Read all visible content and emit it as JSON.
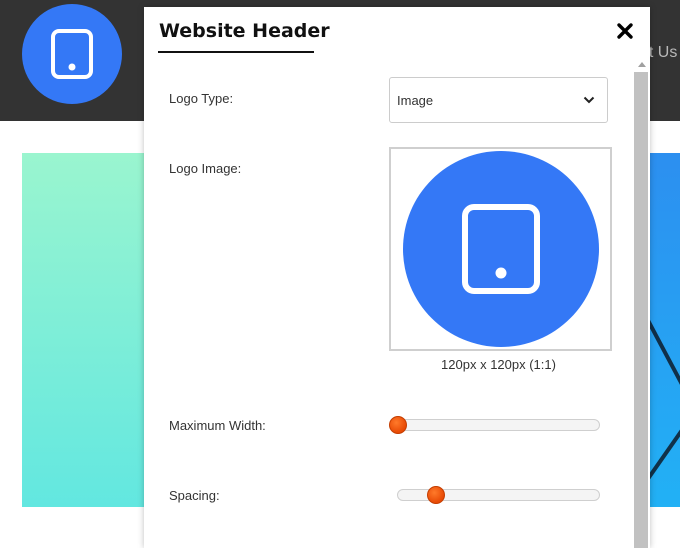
{
  "background": {
    "nav_text": "ut Us",
    "colors": {
      "header": "#333333",
      "logo": "#3478f6"
    }
  },
  "panel": {
    "title": "Website Header",
    "close_icon": "close-icon",
    "fields": {
      "logo_type": {
        "label": "Logo Type:",
        "value": "Image"
      },
      "logo_image": {
        "label": "Logo Image:",
        "caption": "120px x 120px (1:1)",
        "icon": "tablet-icon"
      },
      "max_width": {
        "label": "Maximum Width:",
        "value": 0
      },
      "spacing": {
        "label": "Spacing:",
        "value": 0.19
      }
    }
  },
  "colors": {
    "accent": "#3478f6",
    "slider_thumb": "#f05a0f"
  }
}
